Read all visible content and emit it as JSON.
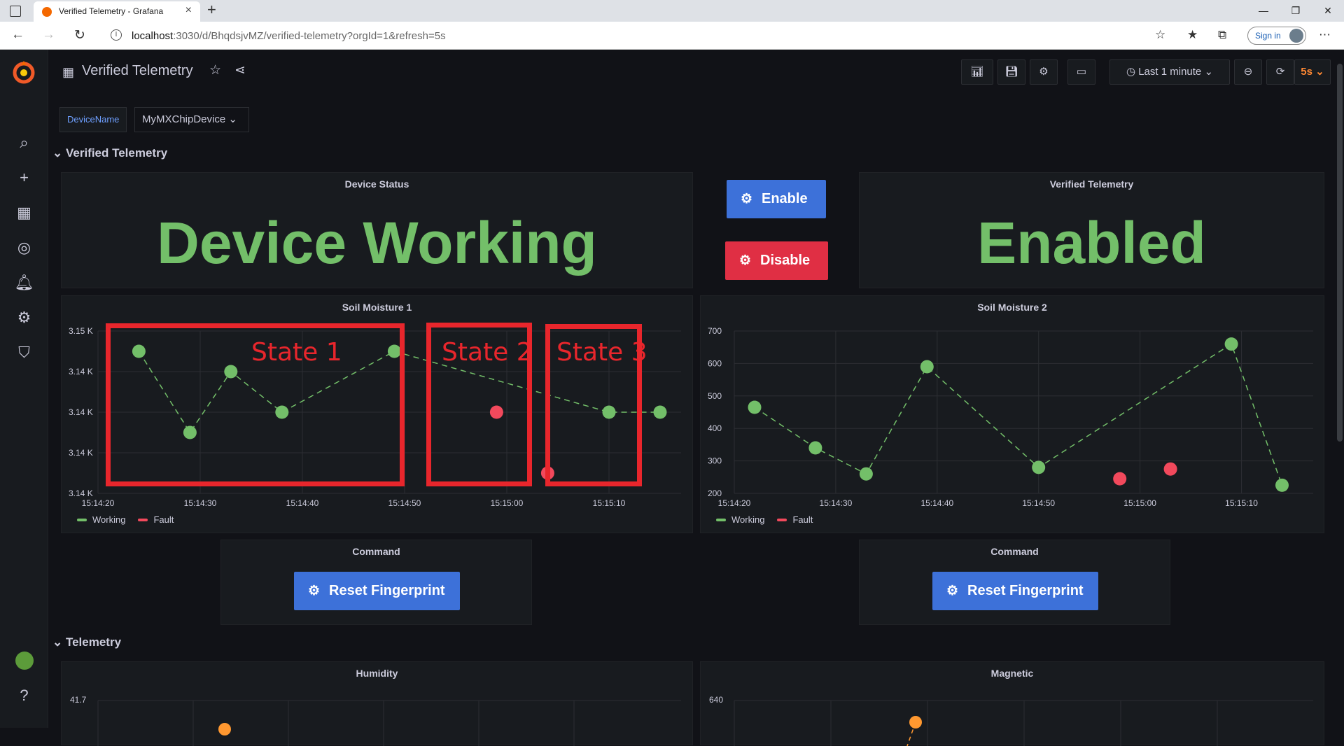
{
  "browser": {
    "tab_title": "Verified Telemetry - Grafana",
    "url_host": "localhost",
    "url_path": ":3030/d/BhqdsjvMZ/verified-telemetry?orgId=1&refresh=5s",
    "sign_in": "Sign in"
  },
  "dashboard": {
    "title": "Verified Telemetry",
    "time_range": "Last 1 minute",
    "refresh": "5s"
  },
  "variable": {
    "label": "DeviceName",
    "value": "MyMXChipDevice"
  },
  "rows": [
    {
      "title": "Verified Telemetry"
    },
    {
      "title": "Telemetry"
    }
  ],
  "panels": {
    "device_status": {
      "title": "Device Status",
      "value": "Device Working"
    },
    "enable_button": "Enable",
    "disable_button": "Disable",
    "verified_telemetry": {
      "title": "Verified Telemetry",
      "value": "Enabled"
    },
    "command_left": {
      "title": "Command",
      "button": "Reset Fingerprint"
    },
    "command_right": {
      "title": "Command",
      "button": "Reset Fingerprint"
    },
    "humidity": {
      "title": "Humidity",
      "ytick": "41.7"
    },
    "magnetic": {
      "title": "Magnetic",
      "ytick": "640"
    }
  },
  "overlay_labels": [
    "State 1",
    "State 2",
    "State 3"
  ],
  "colors": {
    "working": "#73bf69",
    "fault": "#f2495c",
    "enable": "#3d71d9",
    "disable": "#e02f44",
    "orange": "#ff9830"
  },
  "chart_data": [
    {
      "type": "scatter",
      "title": "Soil Moisture 1",
      "x_ticks": [
        "15:14:20",
        "15:14:30",
        "15:14:40",
        "15:14:50",
        "15:15:00",
        "15:15:10"
      ],
      "y_ticks": [
        "3.15 K",
        "3.14 K",
        "3.14 K",
        "3.14 K",
        "3.14 K"
      ],
      "ylim": [
        0,
        4
      ],
      "legend": [
        "Working",
        "Fault"
      ],
      "series": [
        {
          "name": "Working",
          "color": "#73bf69",
          "line": "dashed",
          "points": [
            [
              "15:14:24",
              3.5
            ],
            [
              "15:14:29",
              1.5
            ],
            [
              "15:14:33",
              3.0
            ],
            [
              "15:14:38",
              2.0
            ],
            [
              "15:14:49",
              3.5
            ],
            [
              "15:15:10",
              2.0
            ],
            [
              "15:15:15",
              2.0
            ]
          ]
        },
        {
          "name": "Fault",
          "color": "#f2495c",
          "points": [
            [
              "15:14:59",
              2.0
            ],
            [
              "15:15:04",
              0.5
            ]
          ]
        }
      ]
    },
    {
      "type": "scatter",
      "title": "Soil Moisture 2",
      "x_ticks": [
        "15:14:20",
        "15:14:30",
        "15:14:40",
        "15:14:50",
        "15:15:00",
        "15:15:10"
      ],
      "y_ticks": [
        "700",
        "600",
        "500",
        "400",
        "300",
        "200"
      ],
      "ylim": [
        200,
        700
      ],
      "legend": [
        "Working",
        "Fault"
      ],
      "series": [
        {
          "name": "Working",
          "color": "#73bf69",
          "line": "dashed",
          "points": [
            [
              "15:14:22",
              465
            ],
            [
              "15:14:28",
              340
            ],
            [
              "15:14:33",
              260
            ],
            [
              "15:14:39",
              590
            ],
            [
              "15:14:50",
              280
            ],
            [
              "15:15:09",
              660
            ],
            [
              "15:15:14",
              225
            ]
          ]
        },
        {
          "name": "Fault",
          "color": "#f2495c",
          "points": [
            [
              "15:14:58",
              245
            ],
            [
              "15:15:03",
              275
            ]
          ]
        }
      ]
    }
  ]
}
